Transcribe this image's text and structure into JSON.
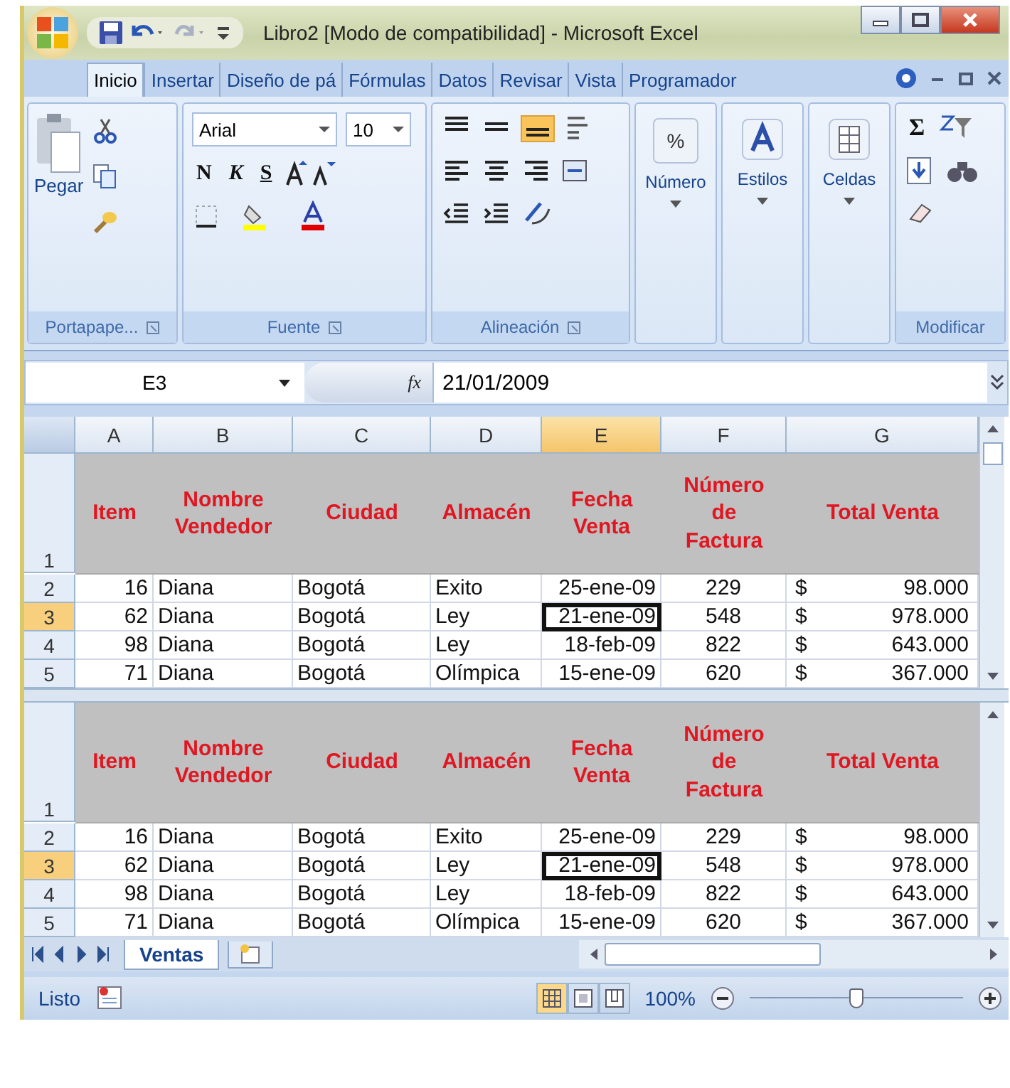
{
  "window": {
    "title": "Libro2  [Modo de compatibilidad] - Microsoft Excel"
  },
  "ribbon_tabs": [
    {
      "label": "Inicio",
      "selected": true
    },
    {
      "label": "Insertar",
      "selected": false
    },
    {
      "label": "Diseño de pá",
      "selected": false
    },
    {
      "label": "Fórmulas",
      "selected": false
    },
    {
      "label": "Datos",
      "selected": false
    },
    {
      "label": "Revisar",
      "selected": false
    },
    {
      "label": "Vista",
      "selected": false
    },
    {
      "label": "Programador",
      "selected": false
    }
  ],
  "ribbon": {
    "clipboard": {
      "paste_label": "Pegar",
      "title": "Portapape..."
    },
    "font": {
      "font_name": "Arial",
      "font_size": "10",
      "bold_label": "N",
      "italic_label": "K",
      "underline_label": "S",
      "title": "Fuente"
    },
    "alignment": {
      "title": "Alineación",
      "bottom_selected": true
    },
    "number": {
      "symbol": "%",
      "label": "Número"
    },
    "styles": {
      "label": "Estilos"
    },
    "cells": {
      "label": "Celdas"
    },
    "editing": {
      "sum_symbol": "Σ",
      "title": "Modificar"
    }
  },
  "formula_bar": {
    "name_box": "E3",
    "function_label": "fx",
    "value": "21/01/2009"
  },
  "panes": [
    {
      "columns": [
        {
          "label": "A",
          "selected": false
        },
        {
          "label": "B",
          "selected": false
        },
        {
          "label": "C",
          "selected": false
        },
        {
          "label": "D",
          "selected": false
        },
        {
          "label": "E",
          "selected": true
        },
        {
          "label": "F",
          "selected": false
        },
        {
          "label": "G",
          "selected": false
        }
      ],
      "header_row": {
        "number": "1",
        "cells": [
          "Item",
          "Nombre\nVendedor",
          "Ciudad",
          "Almacén",
          "Fecha\nVenta",
          "Número\nde\nFactura",
          "Total Venta"
        ]
      },
      "rows": [
        {
          "number": "2",
          "selected": false,
          "cells": [
            {
              "text": "16",
              "active": false
            },
            {
              "text": "Diana",
              "active": false
            },
            {
              "text": "Bogotá",
              "active": false
            },
            {
              "text": "Exito",
              "active": false
            },
            {
              "text": "25-ene-09",
              "active": false
            },
            {
              "text": "229",
              "active": false
            },
            {
              "prefix": "$",
              "text": "98.000",
              "active": false
            }
          ]
        },
        {
          "number": "3",
          "selected": true,
          "cells": [
            {
              "text": "62",
              "active": false
            },
            {
              "text": "Diana",
              "active": false
            },
            {
              "text": "Bogotá",
              "active": false
            },
            {
              "text": "Ley",
              "active": false
            },
            {
              "text": "21-ene-09",
              "active": true
            },
            {
              "text": "548",
              "active": false
            },
            {
              "prefix": "$",
              "text": "978.000",
              "active": false
            }
          ]
        },
        {
          "number": "4",
          "selected": false,
          "cells": [
            {
              "text": "98",
              "active": false
            },
            {
              "text": "Diana",
              "active": false
            },
            {
              "text": "Bogotá",
              "active": false
            },
            {
              "text": "Ley",
              "active": false
            },
            {
              "text": "18-feb-09",
              "active": false
            },
            {
              "text": "822",
              "active": false
            },
            {
              "prefix": "$",
              "text": "643.000",
              "active": false
            }
          ]
        },
        {
          "number": "5",
          "selected": false,
          "cells": [
            {
              "text": "71",
              "active": false
            },
            {
              "text": "Diana",
              "active": false
            },
            {
              "text": "Bogotá",
              "active": false
            },
            {
              "text": "Olímpica",
              "active": false
            },
            {
              "text": "15-ene-09",
              "active": false
            },
            {
              "text": "620",
              "active": false
            },
            {
              "prefix": "$",
              "text": "367.000",
              "active": false
            }
          ]
        }
      ]
    },
    {
      "header_row": {
        "number": "1",
        "cells": [
          "Item",
          "Nombre\nVendedor",
          "Ciudad",
          "Almacén",
          "Fecha\nVenta",
          "Número\nde\nFactura",
          "Total Venta"
        ]
      },
      "rows": [
        {
          "number": "2",
          "selected": false,
          "cells": [
            {
              "text": "16",
              "active": false
            },
            {
              "text": "Diana",
              "active": false
            },
            {
              "text": "Bogotá",
              "active": false
            },
            {
              "text": "Exito",
              "active": false
            },
            {
              "text": "25-ene-09",
              "active": false
            },
            {
              "text": "229",
              "active": false
            },
            {
              "prefix": "$",
              "text": "98.000",
              "active": false
            }
          ]
        },
        {
          "number": "3",
          "selected": true,
          "cells": [
            {
              "text": "62",
              "active": false
            },
            {
              "text": "Diana",
              "active": false
            },
            {
              "text": "Bogotá",
              "active": false
            },
            {
              "text": "Ley",
              "active": false
            },
            {
              "text": "21-ene-09",
              "active": true
            },
            {
              "text": "548",
              "active": false
            },
            {
              "prefix": "$",
              "text": "978.000",
              "active": false
            }
          ]
        },
        {
          "number": "4",
          "selected": false,
          "cells": [
            {
              "text": "98",
              "active": false
            },
            {
              "text": "Diana",
              "active": false
            },
            {
              "text": "Bogotá",
              "active": false
            },
            {
              "text": "Ley",
              "active": false
            },
            {
              "text": "18-feb-09",
              "active": false
            },
            {
              "text": "822",
              "active": false
            },
            {
              "prefix": "$",
              "text": "643.000",
              "active": false
            }
          ]
        },
        {
          "number": "5",
          "selected": false,
          "cells": [
            {
              "text": "71",
              "active": false
            },
            {
              "text": "Diana",
              "active": false
            },
            {
              "text": "Bogotá",
              "active": false
            },
            {
              "text": "Olímpica",
              "active": false
            },
            {
              "text": "15-ene-09",
              "active": false
            },
            {
              "text": "620",
              "active": false
            },
            {
              "prefix": "$",
              "text": "367.000",
              "active": false
            }
          ]
        }
      ]
    }
  ],
  "sheet_tabs": [
    {
      "label": "Ventas",
      "selected": true
    }
  ],
  "status_bar": {
    "status": "Listo",
    "views": [
      {
        "kind": "normal",
        "selected": true
      },
      {
        "kind": "layout",
        "selected": false
      },
      {
        "kind": "pagebreak",
        "selected": false
      }
    ],
    "zoom": "100%",
    "zoom_slider": {
      "level": 0.5
    }
  }
}
